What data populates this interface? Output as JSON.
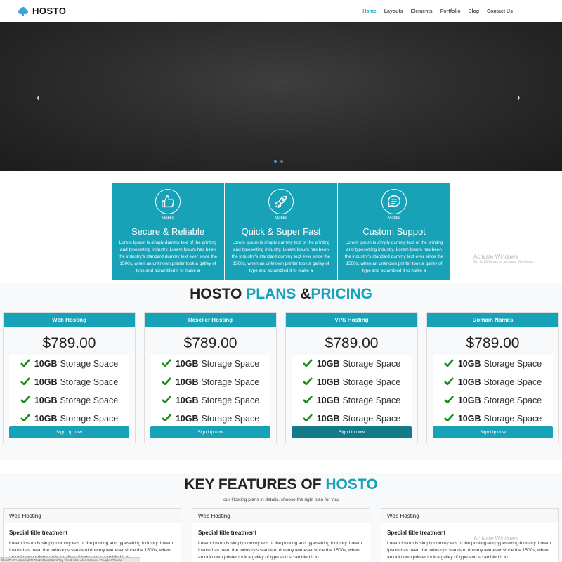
{
  "navbar": {
    "brand": "HOSTO",
    "links": [
      {
        "label": "Home",
        "active": true
      },
      {
        "label": "Layouts",
        "active": false
      },
      {
        "label": "Elements",
        "active": false
      },
      {
        "label": "Portfolio",
        "active": false
      },
      {
        "label": "Blog",
        "active": false
      },
      {
        "label": "Contact Us",
        "active": false
      }
    ]
  },
  "carousel": {
    "prev_arrow": "‹",
    "next_arrow": "›",
    "slide_count": 2,
    "active_slide": 1
  },
  "features": [
    {
      "icon_label": "Moblie",
      "title": "Secure & Reliable",
      "text": "Lorem Ipsum is simply dummy text of the printing and typesetting industry. Lorem Ipsum has been the industry's standard dummy text ever since the 1500s, when an unknown printer took a galley of type and scrambled it to make a"
    },
    {
      "icon_label": "Moblie",
      "title": "Quick & Super Fast",
      "text": "Lorem Ipsum is simply dummy text of the printing and typesetting industry. Lorem Ipsum has been the industry's standard dummy text ever since the 1500s, when an unknown printer took a galley of type and scrambled it to make a"
    },
    {
      "icon_label": "Moblie",
      "title": "Custom Suppot",
      "text": "Lorem Ipsum is simply dummy text of the printing and typesetting industry. Lorem Ipsum has been the industry's standard dummy text ever since the 1500s, when an unknown printer took a galley of type and scrambled it to make a"
    }
  ],
  "watermark": {
    "title": "Activate Windows",
    "subtitle": "Go to Settings to activate Windows."
  },
  "pricing": {
    "title_part1": "HOSTO",
    "title_part2": "PLANS",
    "title_part3": "&",
    "title_part4": "PRICING",
    "plans": [
      {
        "name": "Web Hosting",
        "price": "$789.00",
        "features": [
          {
            "amount": "10GB",
            "label": "Storage Space"
          },
          {
            "amount": "10GB",
            "label": "Storage Space"
          },
          {
            "amount": "10GB",
            "label": "Storage Space"
          },
          {
            "amount": "10GB",
            "label": "Storage Space"
          }
        ],
        "button": "Sign Up now"
      },
      {
        "name": "Reseller Hosting",
        "price": "$789.00",
        "features": [
          {
            "amount": "10GB",
            "label": "Storage Space"
          },
          {
            "amount": "10GB",
            "label": "Storage Space"
          },
          {
            "amount": "10GB",
            "label": "Storage Space"
          },
          {
            "amount": "10GB",
            "label": "Storage Space"
          }
        ],
        "button": "Sign Up now"
      },
      {
        "name": "VPS Hosting",
        "price": "$789.00",
        "features": [
          {
            "amount": "10GB",
            "label": "Storage Space"
          },
          {
            "amount": "10GB",
            "label": "Storage Space"
          },
          {
            "amount": "10GB",
            "label": "Storage Space"
          },
          {
            "amount": "10GB",
            "label": "Storage Space"
          }
        ],
        "button": "Sign Up now"
      },
      {
        "name": "Domain Names",
        "price": "$789.00",
        "features": [
          {
            "amount": "10GB",
            "label": "Storage Space"
          },
          {
            "amount": "10GB",
            "label": "Storage Space"
          },
          {
            "amount": "10GB",
            "label": "Storage Space"
          },
          {
            "amount": "10GB",
            "label": "Storage Space"
          }
        ],
        "button": "Sign Up now"
      }
    ]
  },
  "key_features": {
    "title_part1": "KEY FEATURES OF",
    "title_part2": "HOSTO",
    "subtitle": "our Hosting plans in details. choose the right plan for you",
    "cards": [
      {
        "header": "Web Hosting",
        "title": "Special title treatment",
        "text": "Lorem Ipsum is simply dummy text of the printing and typesetting industry. Lorem Ipsum has been the industry's standard dummy text ever since the 1500s, when an unknown printer took a galley of type and scrambled it to"
      },
      {
        "header": "Web Hosting",
        "title": "Special title treatment",
        "text": "Lorem Ipsum is simply dummy text of the printing and typesetting industry. Lorem Ipsum has been the industry's standard dummy text ever since the 1500s, when an unknown printer took a galley of type and scrambled it to"
      },
      {
        "header": "Web Hosting",
        "title": "Special title treatment",
        "text": "Lorem Ipsum is simply dummy text of the printing and typesetting industry. Lorem Ipsum has been the industry's standard dummy text ever since the 1500s, when an unknown printer took a galley of type and scrambled it to"
      }
    ]
  },
  "statusbar": {
    "text": "file:///D:/ITI Material/ITI Tasks/Bootstrap/Day 2/task.html   Alaa Farouk - Google Chrome"
  },
  "colors": {
    "accent": "#17a2b8",
    "brand_icon": "#3ba5d8"
  }
}
